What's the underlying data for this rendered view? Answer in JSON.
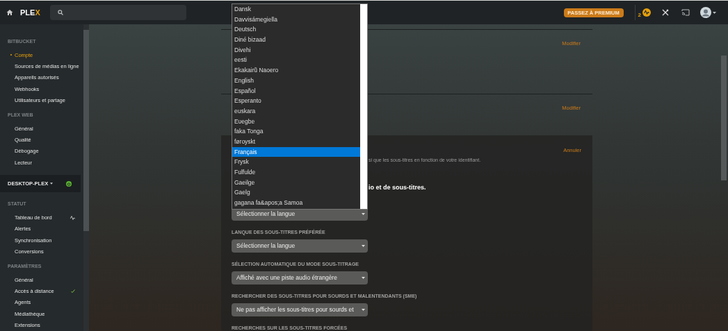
{
  "topbar": {
    "logo": "PLEX",
    "premium_button": "PASSEZ À PREMIUM",
    "notification_count": "2"
  },
  "sidebar": {
    "groups": [
      {
        "header": "BITBUCKET",
        "items": [
          {
            "label": "Compte",
            "selected": true
          },
          {
            "label": "Sources de médias en ligne",
            "selected": false
          },
          {
            "label": "Appareils autorisés",
            "selected": false
          },
          {
            "label": "Webhooks",
            "selected": false
          },
          {
            "label": "Utilisateurs et partage",
            "selected": false
          }
        ]
      },
      {
        "header": "PLEX WEB",
        "items": [
          {
            "label": "Général",
            "selected": false
          },
          {
            "label": "Qualité",
            "selected": false
          },
          {
            "label": "Débogage",
            "selected": false
          },
          {
            "label": "Lecteur",
            "selected": false
          }
        ]
      }
    ],
    "server": {
      "name": "DESKTOP-PLEX",
      "online": true
    },
    "server_groups": [
      {
        "header": "STATUT",
        "items": [
          {
            "label": "Tableau de bord",
            "selected": false,
            "kind": "activity"
          },
          {
            "label": "Alertes",
            "selected": false
          },
          {
            "label": "Synchronisation",
            "selected": false
          },
          {
            "label": "Conversions",
            "selected": false
          }
        ]
      },
      {
        "header": "PARAMÈTRES",
        "items": [
          {
            "label": "Général",
            "selected": false
          },
          {
            "label": "Accès à distance",
            "selected": false,
            "kind": "check"
          },
          {
            "label": "Agents",
            "selected": false
          },
          {
            "label": "Médiathèque",
            "selected": false
          },
          {
            "label": "Extensions",
            "selected": false
          }
        ]
      }
    ]
  },
  "main": {
    "sections": [
      {
        "action": "Modifier"
      },
      {
        "action": "Modifier"
      }
    ],
    "panel": {
      "action": "Annuler",
      "description": "si que les sous-titres en fonction de votre identifiant.",
      "heading": "io et de sous-titres.",
      "fields": [
        {
          "value": "Sélectionner la langue"
        },
        {
          "label": "LANQUE DES SOUS-TITRES PRÉFÉRÉE",
          "value": "Sélectionner la langue"
        },
        {
          "label": "SÉLECTION AUTOMATIQUE DU MODE SOUS-TITRAGE",
          "value": "Affiché avec une piste audio étrangère"
        },
        {
          "label": "RECHERCHER DES SOUS-TITRES POUR SOURDS ET MALENTENDANTS (SME)",
          "value": "Ne pas afficher les sous-titres pour sourds et"
        },
        {
          "label": "RECHERCHES SUR LES SOUS-TITRES FORCÉES"
        }
      ]
    }
  },
  "dropdown": {
    "options": [
      {
        "label": "Dansk",
        "selected": false
      },
      {
        "label": "Davvisámegiella",
        "selected": false
      },
      {
        "label": "Deutsch",
        "selected": false
      },
      {
        "label": "Diné bizaad",
        "selected": false
      },
      {
        "label": "Divehi",
        "selected": false
      },
      {
        "label": "eesti",
        "selected": false
      },
      {
        "label": "Ekakairũ Naoero",
        "selected": false
      },
      {
        "label": "English",
        "selected": false
      },
      {
        "label": "Español",
        "selected": false
      },
      {
        "label": "Esperanto",
        "selected": false
      },
      {
        "label": "euskara",
        "selected": false
      },
      {
        "label": "Eʋegbe",
        "selected": false
      },
      {
        "label": "faka Tonga",
        "selected": false
      },
      {
        "label": "føroyskt",
        "selected": false
      },
      {
        "label": "Français",
        "selected": true
      },
      {
        "label": "Frysk",
        "selected": false
      },
      {
        "label": "Fulfulde",
        "selected": false
      },
      {
        "label": "Gaeilge",
        "selected": false
      },
      {
        "label": "Gaelg",
        "selected": false
      },
      {
        "label": "gagana fa&apos;a Samoa",
        "selected": false
      }
    ]
  }
}
